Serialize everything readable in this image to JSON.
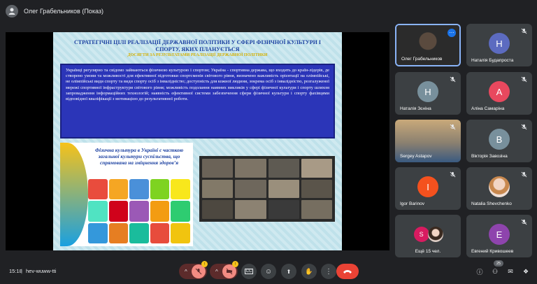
{
  "header": {
    "presenter_title": "Олег Грабельников (Показ)"
  },
  "slide": {
    "title": "СТРАТЕГІЧНІ ЦІЛІ РЕАЛІЗАЦІЇ ДЕРЖАВНОЇ ПОЛІТИКИ У СФЕРІ ФІЗИЧНОЇ КУЛЬТУРИ І СПОРТУ, ЯКИХ ПЛАНУЄТЬСЯ",
    "subtitle": "ДОСЯГТИ ЗА РЕЗУЛЬТАТАМИ РЕАЛІЗАЦІЇ ДЕРЖАВНОЇ ПОЛІТИКИ",
    "body": "Українці регулярно та свідомо займаються фізичною культурою і спортом; Україна - спортивна держава, що входить до країн-лідерів, де створено умови та можливості для ефективної підготовки спортсменів світового рівня, визначено важливість орієнтації на олімпійські, не олімпійські види спорту та види спорту осіб з інвалідністю; доступність для кожної людини, зокрема осіб з інвалідністю, розгалуженої мережі спортивної інфраструктури світового рівня; можливість подолання наявних викликів у сфері фізичної культури і спорту шляхом запровадження інформаційних технологій; наявність ефективної системи забезпечення сфери фізичної культури і спорту фахівцями відповідної кваліфікації з мотивацією до результативної роботи.",
    "infographic_text": "Фізична культура в Україні є часткою загальної культури суспільства, що спрямована на зміцнення здоров’я"
  },
  "participants": [
    {
      "name": "Олег Грабельников",
      "initial": "",
      "color": "#2b2b2b",
      "type": "video"
    },
    {
      "name": "Наталія Будапроста",
      "initial": "Н",
      "color": "#5c6bc0",
      "type": "avatar"
    },
    {
      "name": "Наталія Зєніна",
      "initial": "Н",
      "color": "#78909c",
      "type": "avatar"
    },
    {
      "name": "Аліна Самаріна",
      "initial": "А",
      "color": "#e8485e",
      "type": "avatar"
    },
    {
      "name": "Sergey Astapov",
      "initial": "",
      "color": "#8a8070",
      "type": "video"
    },
    {
      "name": "Вікторія Завозіна",
      "initial": "В",
      "color": "#78909c",
      "type": "avatar"
    },
    {
      "name": "Igor Barinov",
      "initial": "I",
      "color": "#f4511e",
      "type": "avatar"
    },
    {
      "name": "Natalia Shevchenko",
      "initial": "",
      "color": "#f0e0d8",
      "type": "photo"
    },
    {
      "name": "Ещё 15 чел.",
      "initial": "S",
      "color": "#d81b60",
      "type": "group"
    },
    {
      "name": "Евгений Кривошеев",
      "initial": "Е",
      "color": "#8e44ad",
      "type": "avatar"
    }
  ],
  "bottombar": {
    "time": "15:18",
    "separator": "|",
    "meeting_code": "hev-wuww-tti",
    "participant_count": "25"
  },
  "colors": {
    "accent": "#1a73e8",
    "hangup": "#ea4335",
    "mic_off_bg": "#5c2b2b"
  }
}
